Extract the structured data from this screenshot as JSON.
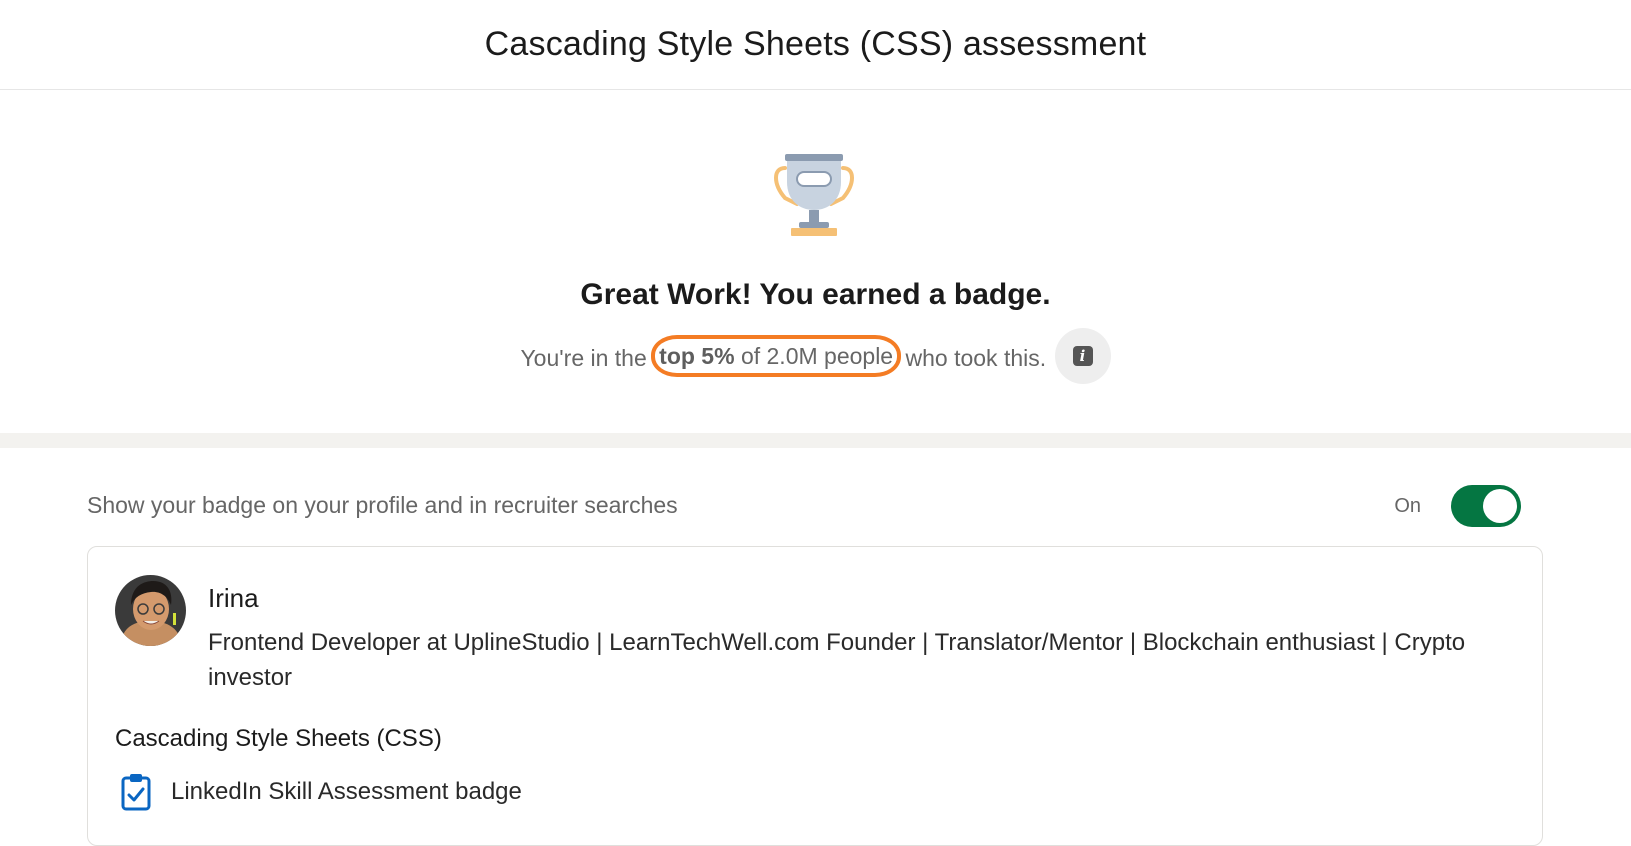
{
  "header": {
    "title": "Cascading Style Sheets (CSS) assessment"
  },
  "result": {
    "congrats": "Great Work! You earned a badge.",
    "stats_prefix": "You're in the",
    "stats_strong": "top 5%",
    "stats_middle": "of 2.0M people",
    "stats_suffix": "who took this.",
    "info_icon": "info-icon"
  },
  "visibility": {
    "label": "Show your badge on your profile and in recruiter searches",
    "state_label": "On",
    "enabled": true
  },
  "card": {
    "name": "Irina",
    "headline": "Frontend Developer at UplineStudio | LearnTechWell.com Founder | Translator/Mentor | Blockchain enthusiast | Crypto investor",
    "skill": "Cascading Style Sheets (CSS)",
    "badge_label": "LinkedIn Skill Assessment badge"
  },
  "colors": {
    "accent_green": "#057642",
    "highlight_orange": "#f47c24",
    "badge_blue": "#0a66c2",
    "trophy_silver": "#c8d3e0",
    "trophy_gold": "#f5c075"
  }
}
